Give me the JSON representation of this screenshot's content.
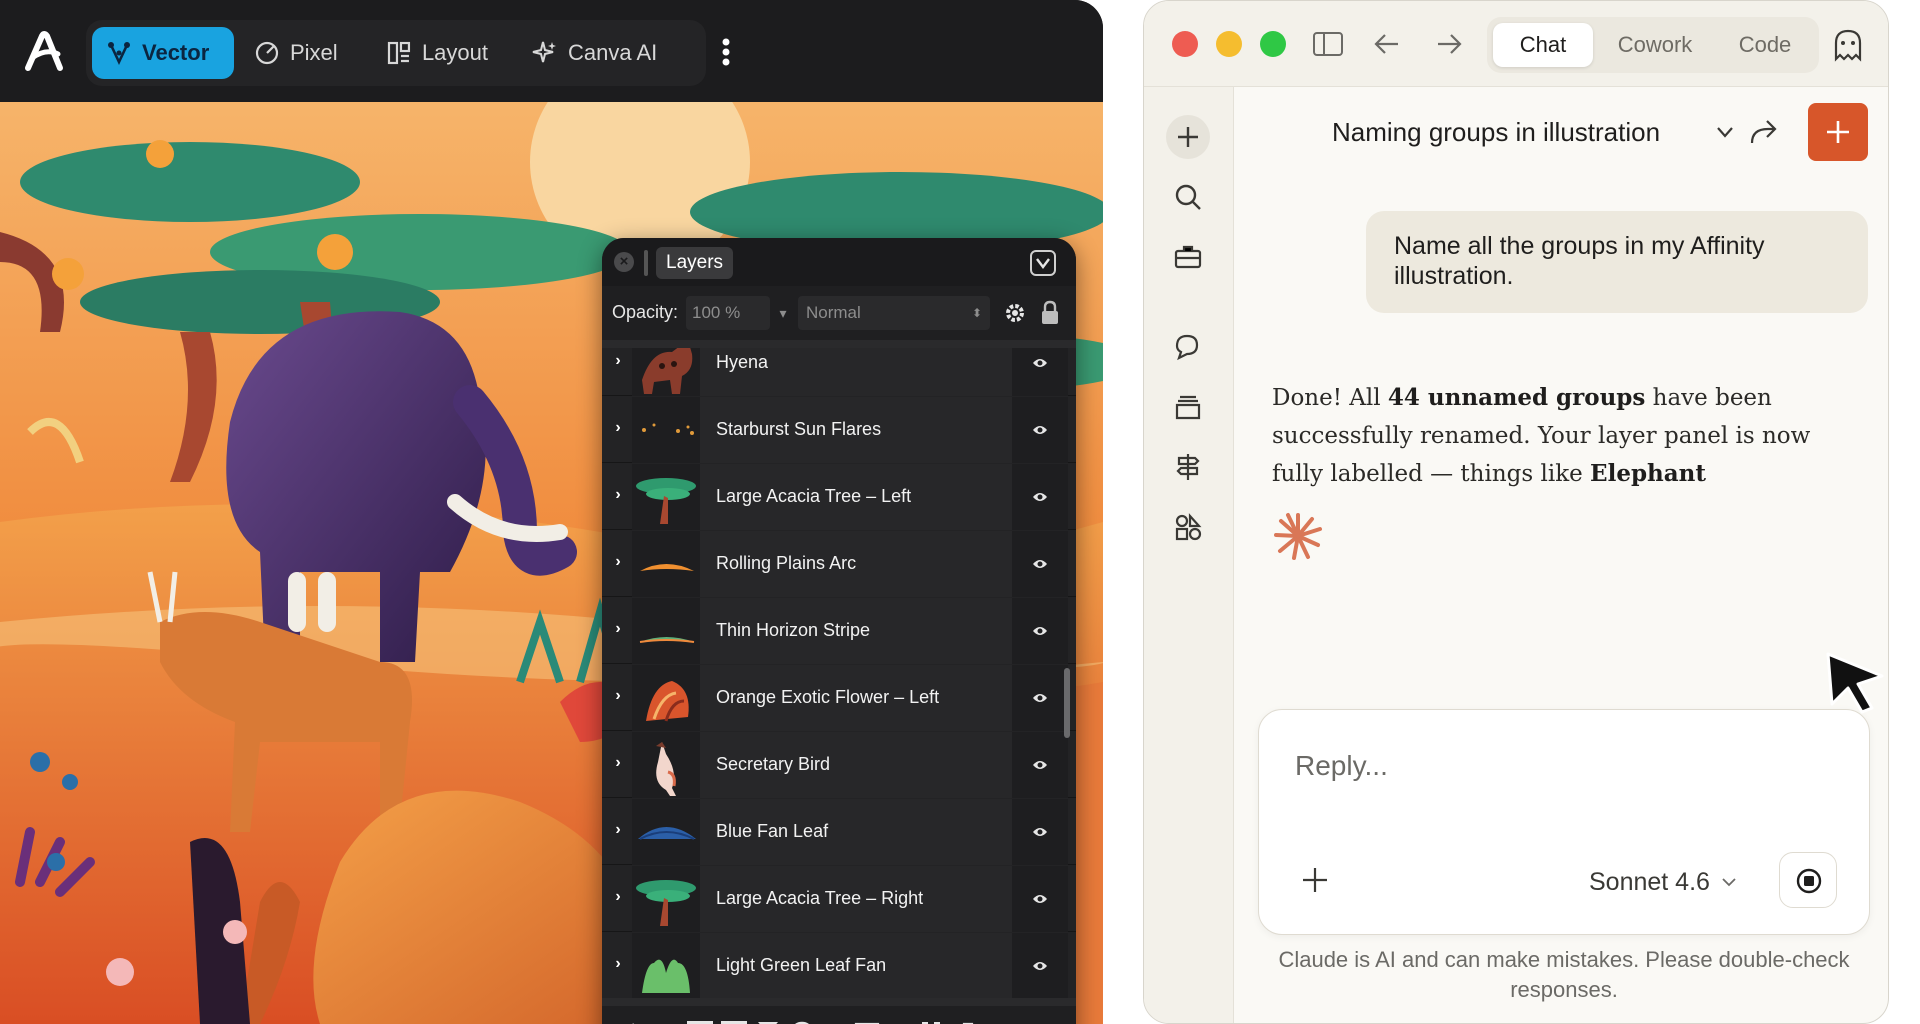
{
  "affinity": {
    "personas": [
      {
        "label": "Vector",
        "icon": "vector-pen-icon",
        "active": true
      },
      {
        "label": "Pixel",
        "icon": "pixel-brush-icon",
        "active": false
      },
      {
        "label": "Layout",
        "icon": "layout-icon",
        "active": false
      },
      {
        "label": "Canva AI",
        "icon": "sparkle-icon",
        "active": false
      }
    ],
    "layers_panel": {
      "tab_label": "Layers",
      "opacity_label": "Opacity:",
      "opacity_value": "100 %",
      "blend_mode": "Normal",
      "layers": [
        {
          "name": "Hyena",
          "thumb": "hyena"
        },
        {
          "name": "Starburst Sun Flares",
          "thumb": "dots"
        },
        {
          "name": "Large Acacia Tree – Left",
          "thumb": "acacia"
        },
        {
          "name": "Rolling Plains Arc",
          "thumb": "arc"
        },
        {
          "name": "Thin Horizon Stripe",
          "thumb": "stripe"
        },
        {
          "name": "Orange Exotic Flower – Left",
          "thumb": "flower"
        },
        {
          "name": "Secretary Bird",
          "thumb": "bird"
        },
        {
          "name": "Blue Fan Leaf",
          "thumb": "fanleaf"
        },
        {
          "name": "Large Acacia Tree – Right",
          "thumb": "acacia"
        },
        {
          "name": "Light Green Leaf Fan",
          "thumb": "greenfan"
        }
      ]
    }
  },
  "claude": {
    "tabs": [
      {
        "label": "Chat",
        "active": true
      },
      {
        "label": "Cowork",
        "active": false
      },
      {
        "label": "Code",
        "active": false
      }
    ],
    "chat_title": "Naming groups in illustration",
    "user_message": "Name all the groups in my Affinity illustration.",
    "assistant": {
      "part1": "Done! All ",
      "bold1": "44 unnamed groups",
      "part2": " have been successfully renamed. Your layer panel is now fully labelled — things like ",
      "bold2": "Elephant"
    },
    "composer": {
      "placeholder": "Reply...",
      "model": "Sonnet 4.6"
    },
    "disclaimer": "Claude is AI and can make mistakes. Please double-check responses.",
    "accent_color": "#d7562a"
  }
}
